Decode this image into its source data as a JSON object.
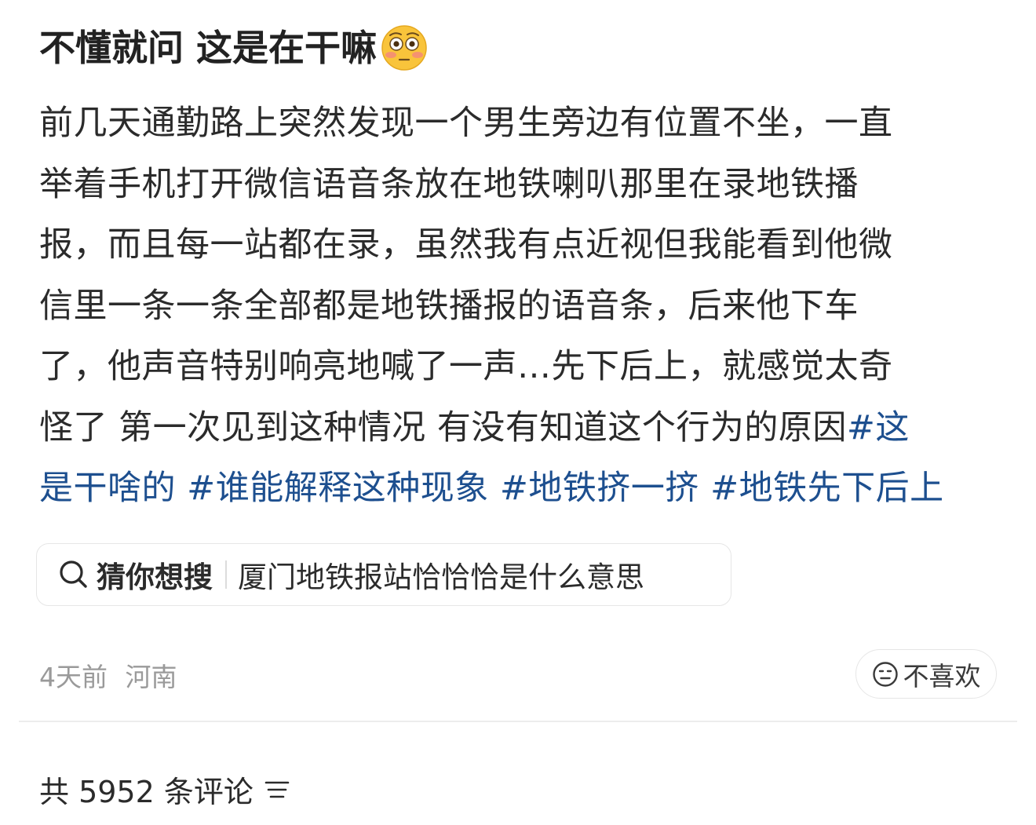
{
  "post": {
    "title": "不懂就问 这是在干嘛",
    "title_emoji": "flushed-face-emoji",
    "body_lines": [
      {
        "text": "前几天通勤路上突然发现一个男生旁边有位置不坐，一直",
        "tag": ""
      },
      {
        "text": "举着手机打开微信语音条放在地铁喇叭那里在录地铁播",
        "tag": ""
      },
      {
        "text": "报，而且每一站都在录，虽然我有点近视但我能看到他微",
        "tag": ""
      },
      {
        "text": "信里一条一条全部都是地铁播报的语音条，后来他下车",
        "tag": ""
      },
      {
        "text": "了，他声音特别响亮地喊了一声…先下后上，就感觉太奇",
        "tag": ""
      },
      {
        "text": "怪了 第一次见到这种情况 有没有知道这个行为的原因",
        "tag": "#这"
      },
      {
        "text": "",
        "tag": "是干啥的 #谁能解释这种现象 #地铁挤一挤 #地铁先下后上"
      }
    ]
  },
  "search_suggestion": {
    "label": "猜你想搜",
    "query": "厦门地铁报站恰恰恰是什么意思",
    "icon": "search-icon"
  },
  "meta": {
    "time": "4天前",
    "location": "河南"
  },
  "dislike_button": {
    "label": "不喜欢",
    "icon": "neutral-face-icon"
  },
  "comments": {
    "count_label": "共 5952 条评论",
    "sort_icon": "sort-icon"
  },
  "colors": {
    "tag": "#1d4f8f",
    "text": "#2b2b2b",
    "muted": "#9a9a9a"
  }
}
